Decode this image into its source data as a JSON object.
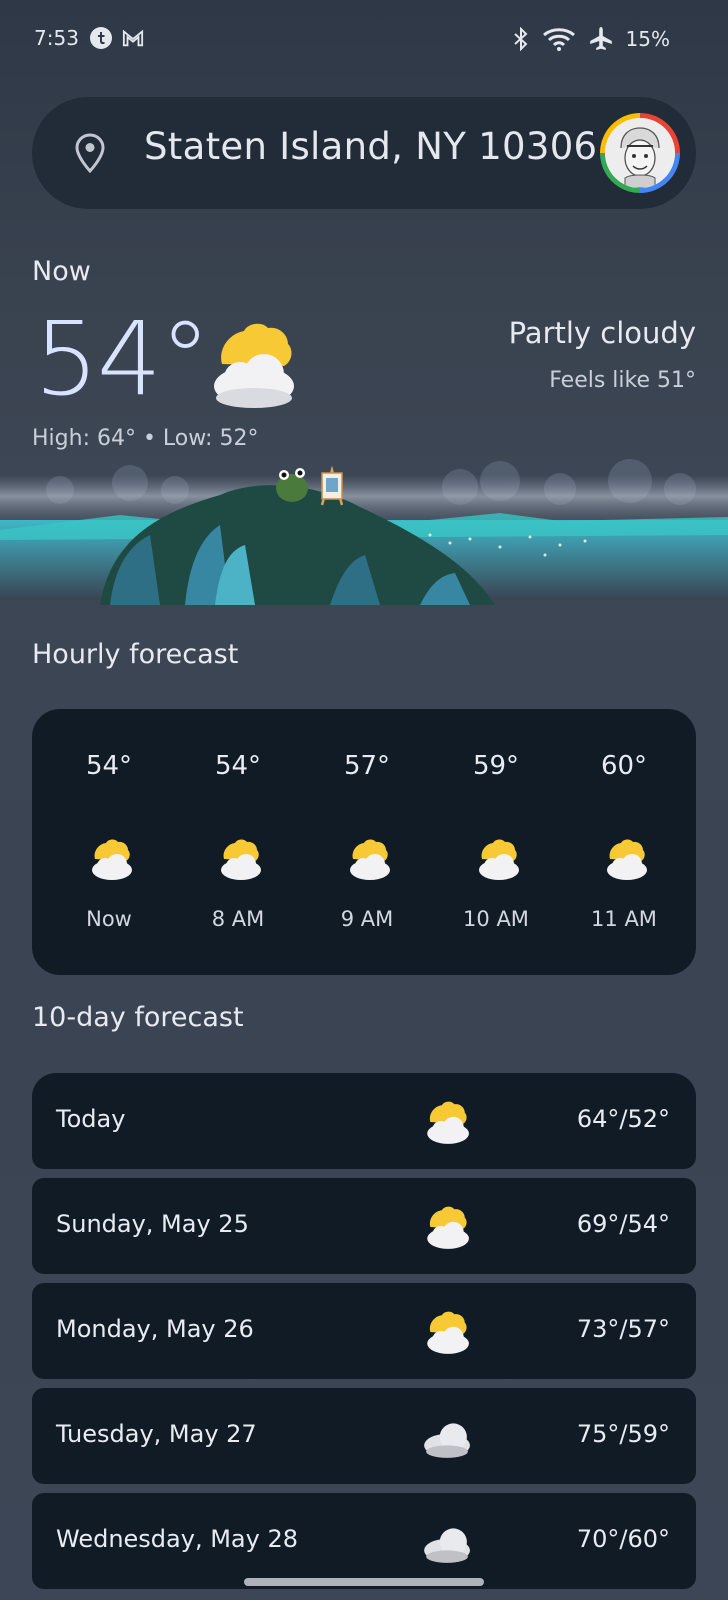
{
  "status_bar": {
    "time": "7:53",
    "battery": "15%",
    "icons": [
      "tumblr-icon",
      "gmail-icon",
      "bluetooth-icon",
      "wifi-icon",
      "airplane-icon"
    ]
  },
  "location": {
    "text": "Staten Island, NY 10306",
    "pin_icon": "location-pin-icon",
    "avatar": "profile-avatar"
  },
  "current": {
    "label": "Now",
    "temperature": "54°",
    "condition": "Partly cloudy",
    "feels_like": "Feels like 51°",
    "high_low": "High: 64° • Low: 52°",
    "icon": "partly-cloudy-icon"
  },
  "hourly": {
    "title": "Hourly forecast",
    "items": [
      {
        "temp": "54°",
        "label": "Now",
        "icon": "partly-cloudy-icon"
      },
      {
        "temp": "54°",
        "label": "8 AM",
        "icon": "partly-cloudy-icon"
      },
      {
        "temp": "57°",
        "label": "9 AM",
        "icon": "partly-cloudy-icon"
      },
      {
        "temp": "59°",
        "label": "10 AM",
        "icon": "partly-cloudy-icon"
      },
      {
        "temp": "60°",
        "label": "11 AM",
        "icon": "partly-cloudy-icon"
      }
    ]
  },
  "daily": {
    "title": "10-day forecast",
    "items": [
      {
        "day": "Today",
        "temps": "64°/52°",
        "icon": "partly-cloudy-icon"
      },
      {
        "day": "Sunday, May 25",
        "temps": "69°/54°",
        "icon": "partly-cloudy-icon"
      },
      {
        "day": "Monday, May 26",
        "temps": "73°/57°",
        "icon": "partly-cloudy-icon"
      },
      {
        "day": "Tuesday, May 27",
        "temps": "75°/59°",
        "icon": "cloudy-icon"
      },
      {
        "day": "Wednesday, May 28",
        "temps": "70°/60°",
        "icon": "cloudy-icon"
      }
    ]
  },
  "colors": {
    "background": "#3a4452",
    "card": "#111b26",
    "sun": "#f7c934",
    "temp_text": "#d8e4ff"
  }
}
